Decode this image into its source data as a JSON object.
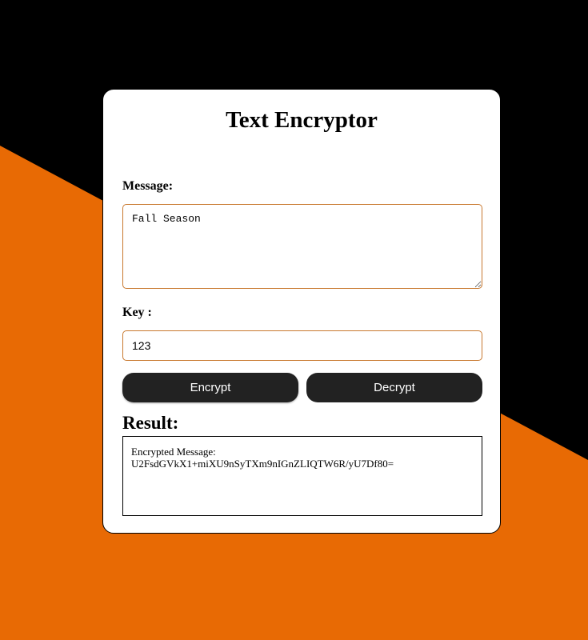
{
  "colors": {
    "background_dark": "#000000",
    "background_accent": "#e86a04",
    "card": "#ffffff",
    "input_border": "#c8782e",
    "button": "#222222",
    "button_text": "#ffffff"
  },
  "title": "Text Encryptor",
  "message": {
    "label": "Message:",
    "value": "Fall Season"
  },
  "key": {
    "label": "Key :",
    "value": "123"
  },
  "buttons": {
    "encrypt_label": "Encrypt",
    "decrypt_label": "Decrypt"
  },
  "result": {
    "heading": "Result:",
    "line1": "Encrypted Message:",
    "line2": "U2FsdGVkX1+miXU9nSyTXm9nIGnZLIQTW6R/yU7Df80="
  }
}
